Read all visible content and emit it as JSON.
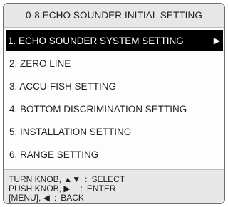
{
  "title": "0-8.ECHO SOUNDER INITIAL SETTING",
  "menu": {
    "items": [
      {
        "label": "1. ECHO SOUNDER SYSTEM SETTING",
        "submenu_icon": "▶",
        "selected": true
      },
      {
        "label": "2. ZERO LINE"
      },
      {
        "label": "3. ACCU-FISH SETTING"
      },
      {
        "label": "4. BOTTOM DISCRIMINATION SETTING"
      },
      {
        "label": "5. INSTALLATION SETTING"
      },
      {
        "label": "6. RANGE SETTING"
      }
    ]
  },
  "help": {
    "rows": [
      {
        "key": "TURN KNOB, ▲▼",
        "sep": ":",
        "action": "SELECT"
      },
      {
        "key": "PUSH KNOB, ▶",
        "sep": ":",
        "action": "ENTER"
      },
      {
        "key": "[MENU], ◀",
        "sep": ":",
        "action": "BACK"
      }
    ]
  },
  "colors": {
    "panel_background": "#e7e7e7",
    "list_background": "#fdfdfd",
    "selected_background": "#000000",
    "selected_text": "#ffffff",
    "border": "#6f6f6f"
  },
  "icons": {
    "submenu": "right-triangle-icon"
  }
}
